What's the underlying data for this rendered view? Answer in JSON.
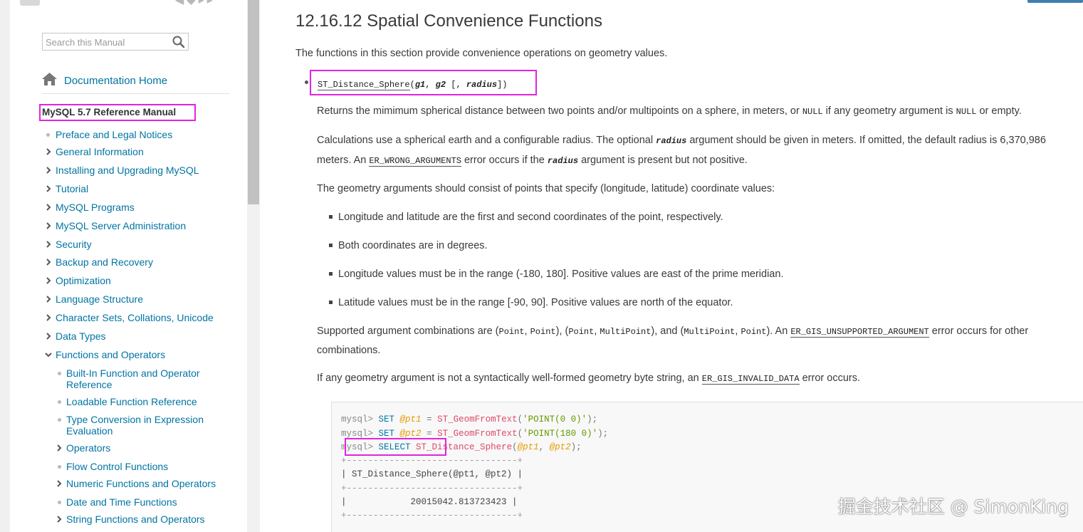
{
  "sidebar": {
    "search_placeholder": "Search this Manual",
    "doc_home": "Documentation Home",
    "manual_title": "MySQL 5.7 Reference Manual",
    "items": [
      {
        "label": "Preface and Legal Notices",
        "marker": "dot"
      },
      {
        "label": "General Information",
        "marker": "chevron-right"
      },
      {
        "label": "Installing and Upgrading MySQL",
        "marker": "chevron-right"
      },
      {
        "label": "Tutorial",
        "marker": "chevron-right"
      },
      {
        "label": "MySQL Programs",
        "marker": "chevron-right"
      },
      {
        "label": "MySQL Server Administration",
        "marker": "chevron-right"
      },
      {
        "label": "Security",
        "marker": "chevron-right"
      },
      {
        "label": "Backup and Recovery",
        "marker": "chevron-right"
      },
      {
        "label": "Optimization",
        "marker": "chevron-right"
      },
      {
        "label": "Language Structure",
        "marker": "chevron-right"
      },
      {
        "label": "Character Sets, Collations, Unicode",
        "marker": "chevron-right"
      },
      {
        "label": "Data Types",
        "marker": "chevron-right"
      },
      {
        "label": "Functions and Operators",
        "marker": "chevron-down"
      }
    ],
    "subitems": [
      {
        "label_line1": "Built-In Function and Operator",
        "label_line2": "Reference",
        "marker": "dot"
      },
      {
        "label_line1": "Loadable Function Reference",
        "label_line2": "",
        "marker": "dot"
      },
      {
        "label_line1": "Type Conversion in Expression",
        "label_line2": "Evaluation",
        "marker": "dot"
      },
      {
        "label_line1": "Operators",
        "label_line2": "",
        "marker": "chevron-right"
      },
      {
        "label_line1": "Flow Control Functions",
        "label_line2": "",
        "marker": "dot"
      },
      {
        "label_line1": "Numeric Functions and Operators",
        "label_line2": "",
        "marker": "chevron-right"
      },
      {
        "label_line1": "Date and Time Functions",
        "label_line2": "",
        "marker": "dot"
      },
      {
        "label_line1": "String Functions and Operators",
        "label_line2": "",
        "marker": "chevron-right"
      }
    ]
  },
  "main": {
    "title": "12.16.12 Spatial Convenience Functions",
    "intro": "The functions in this section provide convenience operations on geometry values.",
    "signature": {
      "name": "ST_Distance_Sphere",
      "open": "(",
      "arg1": "g1",
      "comma1": ", ",
      "arg2": "g2",
      "opt_open": " [, ",
      "arg3": "radius",
      "close": "])"
    },
    "para1": {
      "a": "Returns the mimimum spherical distance between two points and/or multipoints on a sphere, in meters, or ",
      "null1": "NULL",
      "b": " if any geometry argument is ",
      "null2": "NULL",
      "c": " or empty."
    },
    "para2": {
      "a": "Calculations use a spherical earth and a configurable radius. The optional ",
      "radius1": "radius",
      "b": " argument should be given in meters. If omitted, the default radius is 6,370,986",
      "c": "meters. An ",
      "err": "ER_WRONG_ARGUMENTS",
      "d": " error occurs if the ",
      "radius2": "radius",
      "e": " argument is present but not positive."
    },
    "para3": "The geometry arguments should consist of points that specify (longitude, latitude) coordinate values:",
    "bullets": [
      "Longitude and latitude are the first and second coordinates of the point, respectively.",
      "Both coordinates are in degrees.",
      "Longitude values must be in the range (-180, 180]. Positive values are east of the prime meridian.",
      "Latitude values must be in the range [-90, 90]. Positive values are north of the equator."
    ],
    "para4": {
      "a": "Supported argument combinations are (",
      "p1": "Point",
      "s1": ", ",
      "p2": "Point",
      "b": "), (",
      "p3": "Point",
      "s2": ", ",
      "p4": "MultiPoint",
      "c": "), and (",
      "p5": "MultiPoint",
      "s3": ", ",
      "p6": "Point",
      "d": "). An ",
      "err": "ER_GIS_UNSUPPORTED_ARGUMENT",
      "e": " error occurs for other",
      "f": "combinations."
    },
    "para5": {
      "a": "If any geometry argument is not a syntactically well-formed geometry byte string, an ",
      "err": "ER_GIS_INVALID_DATA",
      "b": " error occurs."
    },
    "code": {
      "prompt": "mysql> ",
      "set": "SET",
      "select": "SELECT",
      "pt1": "@pt1",
      "pt2": "@pt2",
      "eq": " = ",
      "geom_fn": "ST_GeomFromText",
      "str1": "'POINT(0 0)'",
      "str2": "'POINT(180 0)'",
      "lp": "(",
      "rp_semi": ");",
      "comma": ", ",
      "dist_fn": "ST_Distance_Sphere",
      "border": "+--------------------------------+",
      "header": "| ST_Distance_Sphere(@pt1, @pt2) |",
      "result": "|            20015042.813723423 |"
    },
    "watermark": "掘金技术社区 @ SimonKing"
  }
}
